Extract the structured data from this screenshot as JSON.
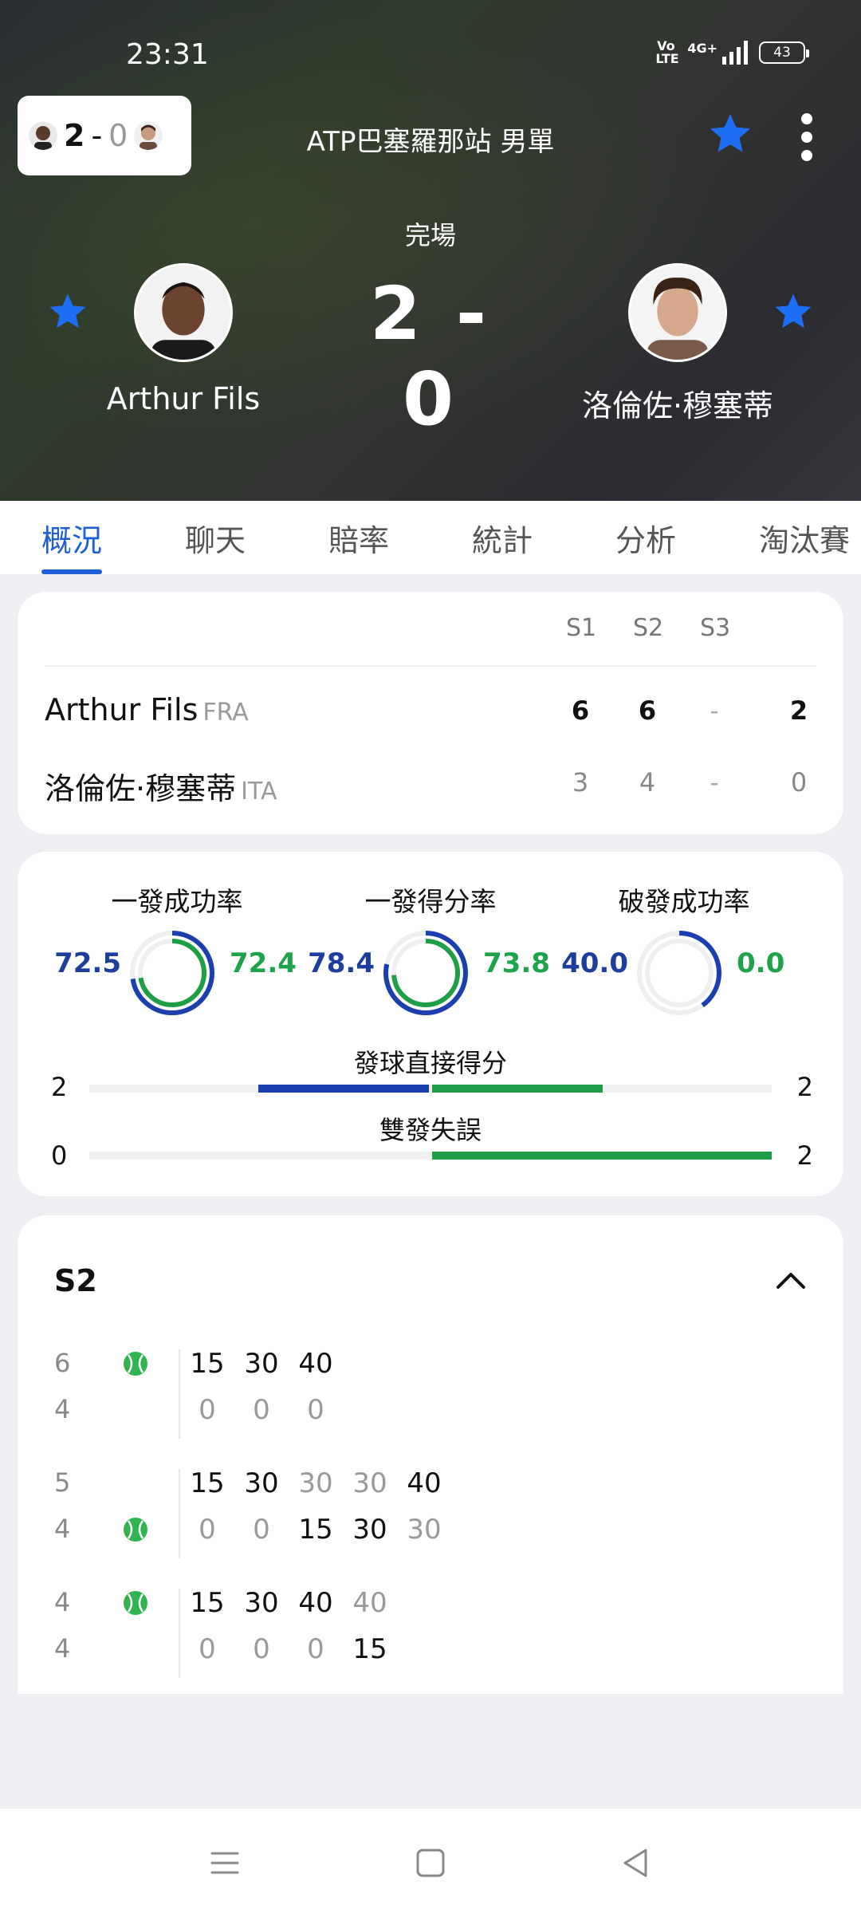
{
  "status_bar": {
    "time": "23:31",
    "volte": "Vo LTE",
    "network": "4G+",
    "battery": "43"
  },
  "header": {
    "mini_score": {
      "home": "2",
      "sep": "-",
      "away": "0"
    },
    "title": "ATP巴塞羅那站 男單",
    "status": "完場",
    "score": "2 - 0",
    "home_player": "Arthur Fils",
    "away_player": "洛倫佐·穆塞蒂"
  },
  "tabs": [
    "概況",
    "聊天",
    "賠率",
    "統計",
    "分析",
    "淘汰賽"
  ],
  "scoreboard": {
    "set_headers": [
      "S1",
      "S2",
      "S3"
    ],
    "rows": [
      {
        "name": "Arthur Fils",
        "country": "FRA",
        "sets": [
          "6",
          "6",
          "-"
        ],
        "total": "2"
      },
      {
        "name": "洛倫佐·穆塞蒂",
        "country": "ITA",
        "sets": [
          "3",
          "4",
          "-"
        ],
        "total": "0"
      }
    ]
  },
  "stats": {
    "rings": [
      {
        "title": "一發成功率",
        "left": "72.5",
        "right": "72.4"
      },
      {
        "title": "一發得分率",
        "left": "78.4",
        "right": "73.8"
      },
      {
        "title": "破發成功率",
        "left": "40.0",
        "right": "0.0"
      }
    ],
    "bars": [
      {
        "label": "發球直接得分",
        "left": "2",
        "right": "2"
      },
      {
        "label": "雙發失誤",
        "left": "0",
        "right": "2"
      }
    ]
  },
  "games": {
    "set_label": "S2",
    "blocks": [
      {
        "top_score": "6",
        "bottom_score": "4",
        "server": "top",
        "top_points": [
          "15",
          "30",
          "40"
        ],
        "bottom_points": [
          "0",
          "0",
          "0"
        ]
      },
      {
        "top_score": "5",
        "bottom_score": "4",
        "server": "bottom",
        "top_points": [
          "15",
          "30",
          "30",
          "30",
          "40"
        ],
        "bottom_points": [
          "0",
          "0",
          "15",
          "30",
          "30"
        ]
      },
      {
        "top_score": "4",
        "bottom_score": "4",
        "server": "top",
        "top_points": [
          "15",
          "30",
          "40",
          "40"
        ],
        "bottom_points": [
          "0",
          "0",
          "0",
          "15"
        ]
      }
    ]
  },
  "colors": {
    "accent_blue": "#1f5fd6",
    "home_blue": "#1d3e9c",
    "away_green": "#1ea34a",
    "star_blue": "#1e6ef5"
  },
  "icons": [
    "star-icon",
    "more-icon",
    "chevron-up-icon",
    "tennis-ball-icon",
    "menu-icon",
    "home-icon",
    "back-icon"
  ]
}
